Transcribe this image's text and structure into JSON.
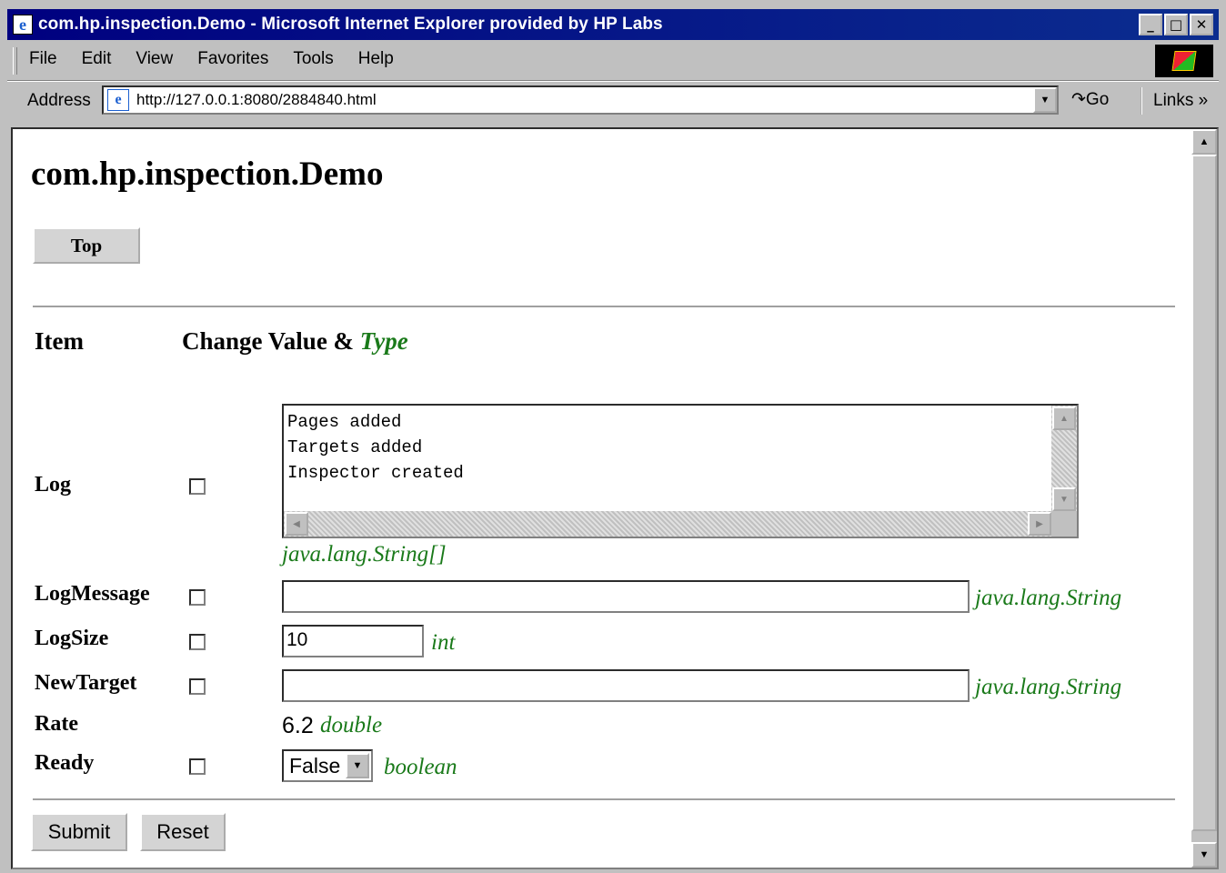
{
  "window": {
    "title": "com.hp.inspection.Demo - Microsoft Internet Explorer provided by HP Labs",
    "minimize": "_",
    "maximize": "□",
    "close": "✕"
  },
  "menu": {
    "file": "File",
    "edit": "Edit",
    "view": "View",
    "favorites": "Favorites",
    "tools": "Tools",
    "help": "Help"
  },
  "address": {
    "label": "Address",
    "url": "http://127.0.0.1:8080/2884840.html",
    "go": "Go",
    "links": "Links »"
  },
  "page": {
    "heading": "com.hp.inspection.Demo",
    "top_button": "Top",
    "col_item": "Item",
    "col_change": "Change Value &",
    "col_type": "Type"
  },
  "fields": {
    "log": {
      "label": "Log",
      "lines": "Pages added\nTargets added\nInspector created",
      "type": "java.lang.String[]"
    },
    "logmessage": {
      "label": "LogMessage",
      "value": "",
      "type": "java.lang.String"
    },
    "logsize": {
      "label": "LogSize",
      "value": "10",
      "type": "int"
    },
    "newtarget": {
      "label": "NewTarget",
      "value": "",
      "type": "java.lang.String"
    },
    "rate": {
      "label": "Rate",
      "value": "6.2",
      "type": "double"
    },
    "ready": {
      "label": "Ready",
      "value": "False",
      "type": "boolean"
    }
  },
  "form": {
    "submit": "Submit",
    "reset": "Reset"
  },
  "colors": {
    "titlebar": "#000080",
    "type_green": "#1a7a1a"
  },
  "icons": [
    "ie-logo-icon",
    "windows-logo-icon",
    "go-arrow-icon",
    "dropdown-arrow-icon",
    "scroll-up-icon",
    "scroll-down-icon"
  ]
}
